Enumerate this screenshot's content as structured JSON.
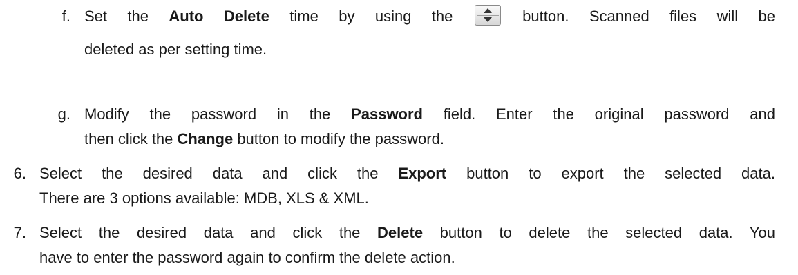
{
  "steps": {
    "f": {
      "marker": "f.",
      "l1_pre": "Set the ",
      "l1_bold": "Auto Delete",
      "l1_mid": " time by using the ",
      "spin_icon": "spinner-updown-icon",
      "l1_post": " button. Scanned files will be",
      "l2": "deleted as per setting time."
    },
    "g": {
      "marker": "g.",
      "l1_pre": "Modify the password in the ",
      "l1_bold": "Password",
      "l1_post": " field. Enter the original password and",
      "l2_pre": "then click the ",
      "l2_bold": "Change",
      "l2_post": " button to modify the password."
    },
    "s6": {
      "marker": "6.",
      "l1_pre": "Select the desired data and click the ",
      "l1_bold": "Export",
      "l1_post": " button to export the selected data.",
      "l2": "There are 3 options available: MDB, XLS & XML."
    },
    "s7": {
      "marker": "7.",
      "l1_pre": "Select the desired data and click the ",
      "l1_bold": "Delete",
      "l1_post": " button to delete the selected data. You",
      "l2": "have to enter the password again to confirm the delete action."
    }
  }
}
